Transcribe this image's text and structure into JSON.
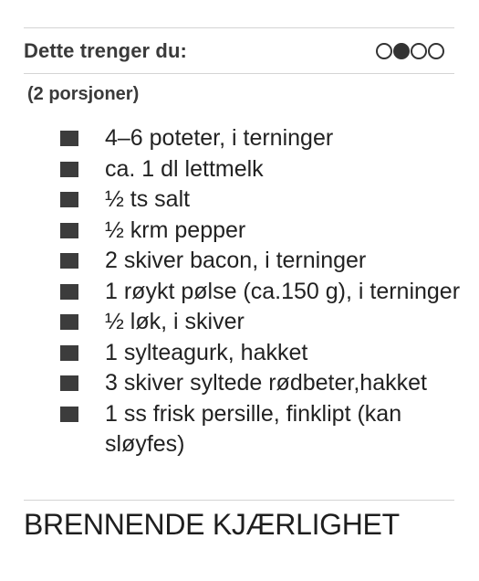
{
  "header": {
    "title": "Dette trenger du:",
    "difficulty_level": 2,
    "difficulty_max": 4
  },
  "servings": "(2 porsjoner)",
  "ingredients": [
    "4–6 poteter, i terninger",
    "ca. 1 dl lettmelk",
    "½ ts salt",
    "½ krm pepper",
    "2 skiver bacon, i terninger",
    "1 røykt pølse (ca.150 g), i terninger",
    "½ løk, i skiver",
    "1 sylteagurk, hakket",
    "3 skiver syltede rødbeter,hakket",
    "1 ss frisk persille, finklipt (kan sløyfes)"
  ],
  "recipe_title": "BRENNENDE KJÆRLIGHET"
}
